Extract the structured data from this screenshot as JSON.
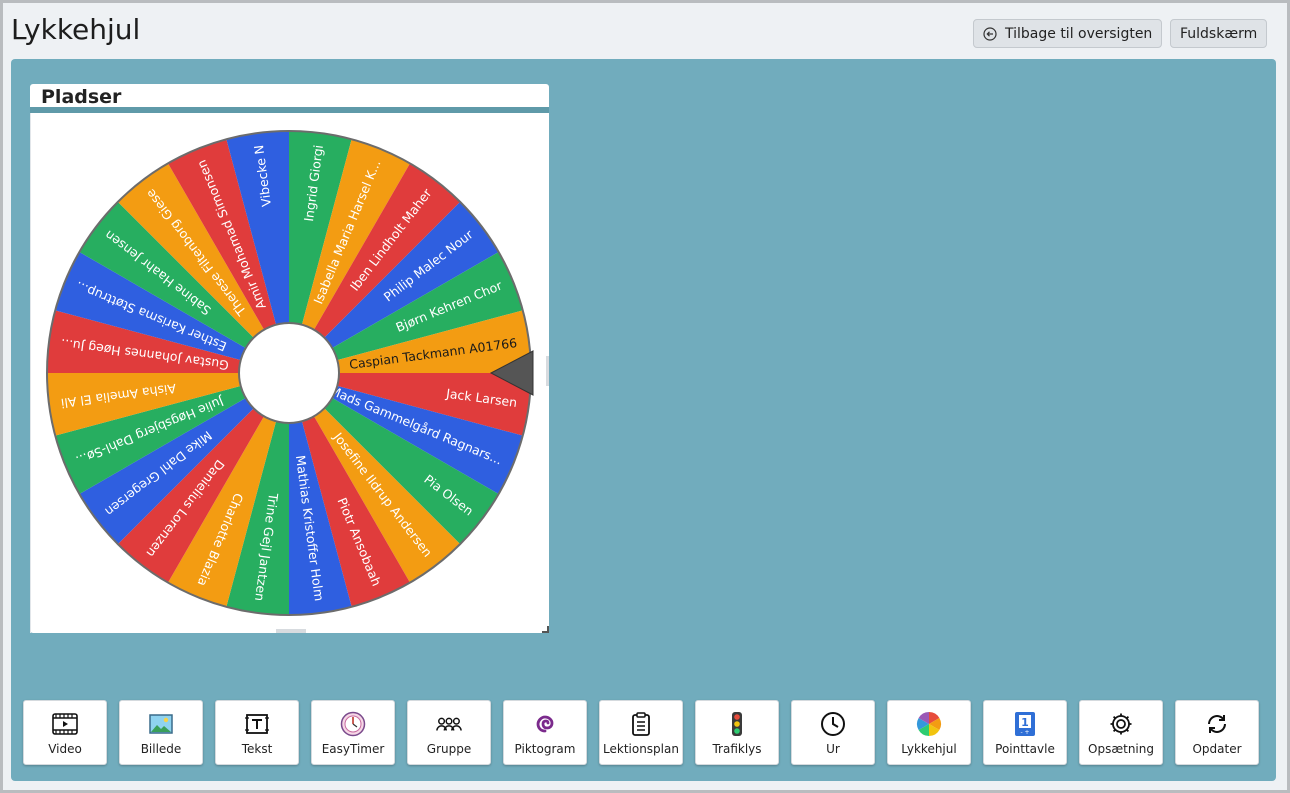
{
  "header": {
    "title": "Lykkehjul",
    "back_label": "Tilbage til oversigten",
    "fullscreen_label": "Fuldskærm"
  },
  "widget": {
    "title": "Pladser",
    "wheel": {
      "segments": [
        {
          "name": "Ingrid Giorgi",
          "color": "#27ae60",
          "text_color": "#ffffff"
        },
        {
          "name": "Isabella Maria Harsel K...",
          "color": "#f39c12",
          "text_color": "#ffffff"
        },
        {
          "name": "Iben Lindholt Maher",
          "color": "#e03c3c",
          "text_color": "#ffffff"
        },
        {
          "name": "Philip Malec Nour",
          "color": "#2f5fe0",
          "text_color": "#ffffff"
        },
        {
          "name": "Bjørn Kehren Chor",
          "color": "#27ae60",
          "text_color": "#ffffff"
        },
        {
          "name": "Caspian Tackmann A01766",
          "color": "#f39c12",
          "text_color": "#1a1a1a"
        },
        {
          "name": "Jack Larsen",
          "color": "#e03c3c",
          "text_color": "#ffffff"
        },
        {
          "name": "Mads Gammelgård Ragnars...",
          "color": "#2f5fe0",
          "text_color": "#ffffff"
        },
        {
          "name": "Pia Olsen",
          "color": "#27ae60",
          "text_color": "#ffffff"
        },
        {
          "name": "Josefine Ildrup Andersen",
          "color": "#f39c12",
          "text_color": "#ffffff"
        },
        {
          "name": "Piotr Ansobaah",
          "color": "#e03c3c",
          "text_color": "#ffffff"
        },
        {
          "name": "Mathias Kristoffer Holm",
          "color": "#2f5fe0",
          "text_color": "#ffffff"
        },
        {
          "name": "Trine Gejl Jantzen",
          "color": "#27ae60",
          "text_color": "#ffffff"
        },
        {
          "name": "Charlotte Blazia",
          "color": "#f39c12",
          "text_color": "#ffffff"
        },
        {
          "name": "Danielius Lorenzen",
          "color": "#e03c3c",
          "text_color": "#ffffff"
        },
        {
          "name": "Mike Dahl Gregersen",
          "color": "#2f5fe0",
          "text_color": "#ffffff"
        },
        {
          "name": "Julie Høgsbjerg Dahl-Sø...",
          "color": "#27ae60",
          "text_color": "#ffffff"
        },
        {
          "name": "Aisha Amelia El Ali",
          "color": "#f39c12",
          "text_color": "#ffffff"
        },
        {
          "name": "Gustav Johannes Høeg Ju...",
          "color": "#e03c3c",
          "text_color": "#ffffff"
        },
        {
          "name": "Esther Karisma Støttrup...",
          "color": "#2f5fe0",
          "text_color": "#ffffff"
        },
        {
          "name": "Sabine Haahr Jensen",
          "color": "#27ae60",
          "text_color": "#ffffff"
        },
        {
          "name": "Therese Filtenborg Giese",
          "color": "#f39c12",
          "text_color": "#ffffff"
        },
        {
          "name": "Amir Mohamad Simonsen",
          "color": "#e03c3c",
          "text_color": "#ffffff"
        },
        {
          "name": "Vibecke N",
          "color": "#2f5fe0",
          "text_color": "#ffffff"
        }
      ]
    }
  },
  "toolbar": [
    {
      "label": "Video",
      "icon": "video-icon"
    },
    {
      "label": "Billede",
      "icon": "image-icon"
    },
    {
      "label": "Tekst",
      "icon": "text-icon"
    },
    {
      "label": "EasyTimer",
      "icon": "easytimer-icon"
    },
    {
      "label": "Gruppe",
      "icon": "group-icon"
    },
    {
      "label": "Piktogram",
      "icon": "pictogram-icon"
    },
    {
      "label": "Lektionsplan",
      "icon": "clipboard-icon"
    },
    {
      "label": "Trafiklys",
      "icon": "traffic-light-icon"
    },
    {
      "label": "Ur",
      "icon": "clock-icon"
    },
    {
      "label": "Lykkehjul",
      "icon": "color-wheel-icon"
    },
    {
      "label": "Pointtavle",
      "icon": "scoreboard-icon"
    },
    {
      "label": "Opsætning",
      "icon": "gear-icon"
    },
    {
      "label": "Opdater",
      "icon": "refresh-icon"
    }
  ]
}
